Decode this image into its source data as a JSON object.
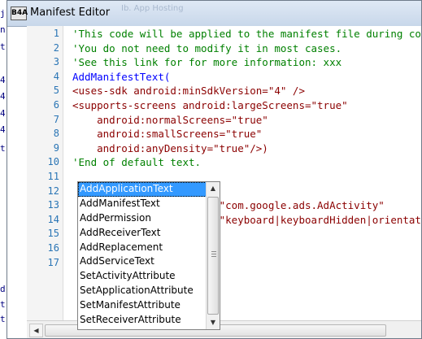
{
  "window": {
    "icon_text": "B4A",
    "title": "Manifest Editor",
    "background_hint": "Ib. App Hosting"
  },
  "left_strip": [
    "j",
    "n",
    "t",
    "4",
    "4",
    "4",
    "4",
    "t",
    "d",
    "t",
    "t"
  ],
  "editor": {
    "colors": {
      "comment": "#008000",
      "keyword": "#0000ff",
      "tag": "#8b0000",
      "string": "#8b0000",
      "line_number": "#2a75b5"
    },
    "line_numbers": [
      "1",
      "2",
      "3",
      "4",
      "5",
      "6",
      "7",
      "8",
      "9",
      "10",
      "11",
      "12",
      "13",
      "14",
      "15",
      "16",
      "17"
    ],
    "lines": [
      {
        "text": "'This code will be applied to the manifest file during compilation.",
        "kind": "comment"
      },
      {
        "text": "'You do not need to modify it in most cases.",
        "kind": "comment"
      },
      {
        "text": "'See this link for for more information: xxx",
        "kind": "comment"
      },
      {
        "text": "AddManifestText(",
        "kind": "keyword"
      },
      {
        "text": "<uses-sdk android:minSdkVersion=\"4\" />",
        "kind": "tag"
      },
      {
        "text": "<supports-screens android:largeScreens=\"true\"",
        "kind": "tag"
      },
      {
        "text": "    android:normalScreens=\"true\"",
        "kind": "tag"
      },
      {
        "text": "    android:smallScreens=\"true\"",
        "kind": "tag"
      },
      {
        "text": "    android:anyDensity=\"true\"/>)",
        "kind": "tag"
      },
      {
        "text": "'End of default text.",
        "kind": "comment"
      },
      {
        "text": "",
        "kind": "plain"
      },
      {
        "text": "",
        "kind": "plain"
      },
      {
        "text": "                      e=\"com.google.ads.AdActivity\"",
        "kind": "string"
      },
      {
        "text": "                      s=\"keyboard|keyboardHidden|orientation\"",
        "kind": "string"
      },
      {
        "text": "",
        "kind": "plain"
      },
      {
        "text": "",
        "kind": "plain"
      },
      {
        "text": "",
        "kind": "plain"
      }
    ]
  },
  "autocomplete": {
    "selected_index": 0,
    "items": [
      "AddApplicationText",
      "AddManifestText",
      "AddPermission",
      "AddReceiverText",
      "AddReplacement",
      "AddServiceText",
      "SetActivityAttribute",
      "SetApplicationAttribute",
      "SetManifestAttribute",
      "SetReceiverAttribute"
    ]
  },
  "icons": {
    "scroll_left": "arrow-left-icon",
    "scroll_up": "arrow-up-icon",
    "scroll_down": "arrow-down-icon"
  }
}
